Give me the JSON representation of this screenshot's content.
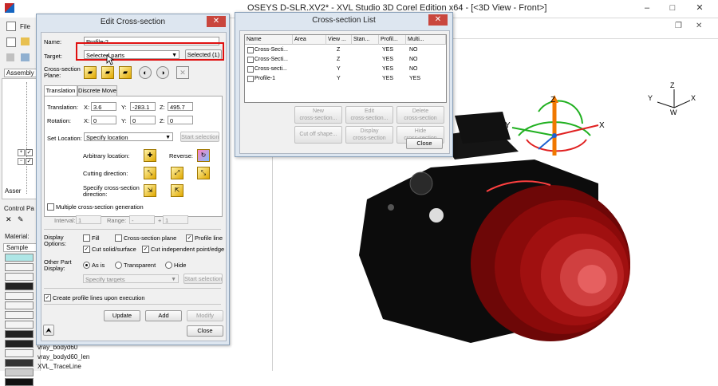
{
  "main_window": {
    "title": "OSEYS D-SLR.XV2* - XVL Studio 3D Corel Edition x64 - [<3D View - Front>]",
    "min": "–",
    "max": "□",
    "close": "✕",
    "mdi_restore": "❐",
    "mdi_close": "✕"
  },
  "left_panel": {
    "file_menu": "File",
    "assembly_label": "Assembly",
    "assembly_tab2": "Asser",
    "control_label": "Control Pa",
    "material_label": "Material:",
    "sample_label": "Sample",
    "materials": [
      "vray_bodyd60",
      "vray_bodyd60_len",
      "XVL_TraceLine"
    ]
  },
  "edit_dialog": {
    "title": "Edit Cross-section",
    "close": "✕",
    "name_label": "Name:",
    "name_value": "Profile-2",
    "target_label": "Target:",
    "target_value": "Selected parts",
    "selected_button": "Selected (1)",
    "plane_label": "Cross-section\nPlane:",
    "tabs": [
      "Translation",
      "Discrete Move"
    ],
    "translation_label": "Translation:",
    "rotation_label": "Rotation:",
    "tx": "3.6",
    "ty": "-283.1",
    "tz": "495.7",
    "rx": "0",
    "ry": "0",
    "rz": "0",
    "x_label": "X:",
    "y_label": "Y:",
    "z_label": "Z:",
    "set_location_label": "Set Location:",
    "set_location_value": "Specify location",
    "start_selection": "Start selection",
    "arbitrary_location": "Arbitrary location:",
    "reverse": "Reverse:",
    "cutting_direction": "Cutting direction:",
    "specify_direction": "Specify cross-section\ndirection:",
    "multiple_label": "Multiple cross-section generation",
    "interval_label": "Interval:",
    "interval_value": "1",
    "range_label": "Range:",
    "range_from": "-",
    "range_to": "1",
    "range_plus": "+",
    "display_options_label": "Display\nOptions:",
    "fill": "Fill",
    "cross_section_plane": "Cross-section plane",
    "profile_line": "Profile line",
    "cut_solid": "Cut solid/surface",
    "cut_independent": "Cut independent point/edge",
    "other_part_display": "Other Part\nDisplay:",
    "as_is": "As is",
    "transparent": "Transparent",
    "hide": "Hide",
    "specify_targets": "Specify targets",
    "create_profile_lines": "Create profile lines upon execution",
    "update": "Update",
    "add": "Add",
    "modify": "Modify",
    "close_button": "Close",
    "collapse": "⮝"
  },
  "list_dialog": {
    "title": "Cross-section List",
    "close": "✕",
    "columns": [
      "Name",
      "Area",
      "View ...",
      "Stan...",
      "Profil...",
      "Multi..."
    ],
    "rows": [
      [
        "Cross-Secti...",
        "",
        "Z",
        "",
        "YES",
        "NO"
      ],
      [
        "Cross-Secti...",
        "",
        "Z",
        "",
        "YES",
        "NO"
      ],
      [
        "Cross-secti...",
        "",
        "Y",
        "",
        "YES",
        "NO"
      ],
      [
        "Profile-1",
        "",
        "Y",
        "",
        "YES",
        "YES"
      ]
    ],
    "buttons": [
      "New\ncross-section...",
      "Edit\ncross-section...",
      "Delete\ncross-section",
      "Cut off shape...",
      "Display\ncross-section",
      "Hide\ncross-section"
    ],
    "close_button": "Close"
  },
  "view3d": {
    "triad_main": {
      "z": "Z",
      "x": "X",
      "y": "Y"
    },
    "triad_corner": {
      "z": "Z",
      "x": "X",
      "y": "Y",
      "w": "W"
    }
  },
  "colors": {
    "highlight": "#e01010",
    "lens_red": "#b01010",
    "body_black": "#0c0c0c",
    "axis_orange": "#f07800",
    "axis_green": "#20b020",
    "axis_red": "#e02020"
  }
}
